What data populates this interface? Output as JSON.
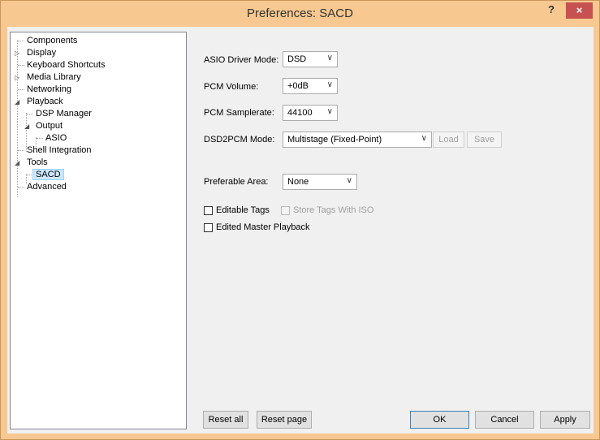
{
  "window": {
    "title": "Preferences: SACD",
    "help_glyph": "?",
    "close_glyph": "×"
  },
  "tree": {
    "items": [
      {
        "label": "Components"
      },
      {
        "label": "Display"
      },
      {
        "label": "Keyboard Shortcuts"
      },
      {
        "label": "Media Library"
      },
      {
        "label": "Networking"
      },
      {
        "label": "Playback"
      },
      {
        "label": "DSP Manager"
      },
      {
        "label": "Output"
      },
      {
        "label": "ASIO"
      },
      {
        "label": "Shell Integration"
      },
      {
        "label": "Tools"
      },
      {
        "label": "SACD"
      },
      {
        "label": "Advanced"
      }
    ],
    "collapsed_glyph": "▷",
    "expanded_glyph": "◢",
    "selected": "SACD"
  },
  "settings": {
    "asio_driver_mode": {
      "label": "ASIO Driver Mode:",
      "value": "DSD"
    },
    "pcm_volume": {
      "label": "PCM Volume:",
      "value": "+0dB"
    },
    "pcm_samplerate": {
      "label": "PCM Samplerate:",
      "value": "44100"
    },
    "dsd2pcm_mode": {
      "label": "DSD2PCM Mode:",
      "value": "Multistage (Fixed-Point)"
    },
    "load_label": "Load",
    "save_label": "Save",
    "preferable_area": {
      "label": "Preferable Area:",
      "value": "None"
    },
    "editable_tags": {
      "label": "Editable Tags",
      "checked": false
    },
    "store_tags_with_iso": {
      "label": "Store Tags With ISO",
      "checked": false,
      "enabled": false
    },
    "edited_master_playback": {
      "label": "Edited Master Playback",
      "checked": false
    }
  },
  "footer": {
    "reset_all": "Reset all",
    "reset_page": "Reset page",
    "ok": "OK",
    "cancel": "Cancel",
    "apply": "Apply"
  },
  "dropdown_arrow": "∨"
}
